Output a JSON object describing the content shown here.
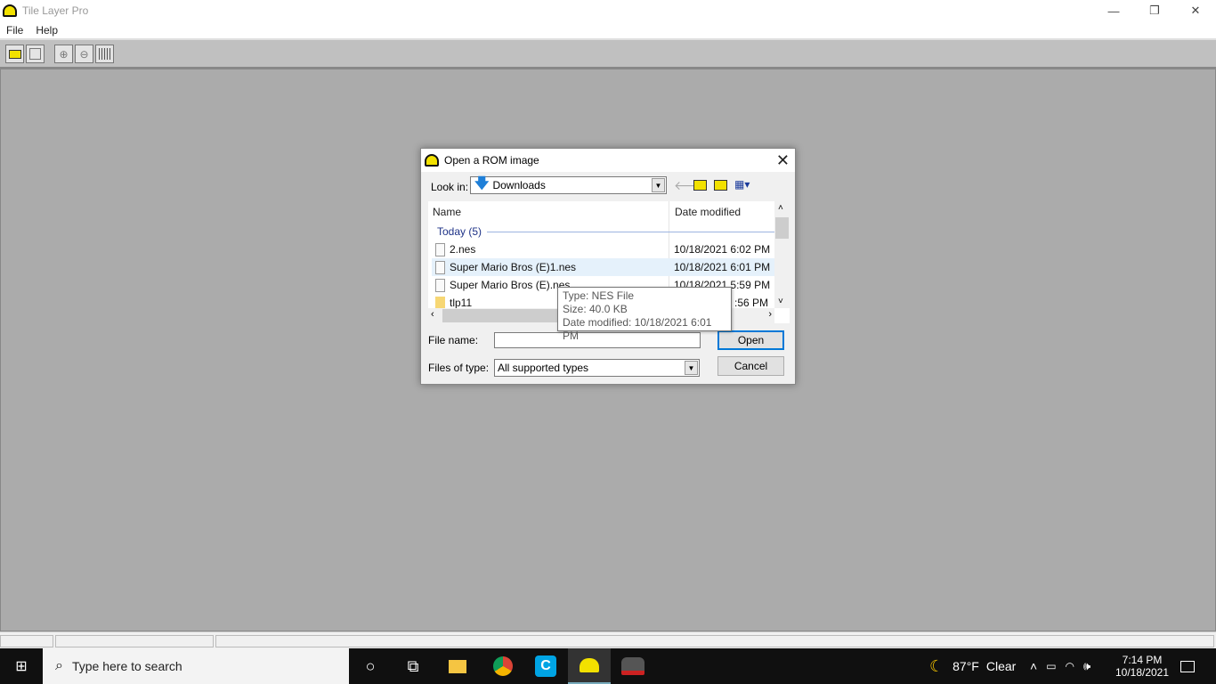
{
  "window": {
    "title": "Tile Layer Pro",
    "minimize": "—",
    "restore": "❐",
    "close": "✕"
  },
  "menu": [
    "File",
    "Help"
  ],
  "toolbar": {
    "icons": [
      "open-folder-icon",
      "save-icon",
      "zoom-in-icon",
      "zoom-out-icon",
      "grid-icon"
    ]
  },
  "dialog": {
    "title": "Open a ROM image",
    "close": "✕",
    "look_in_label": "Look in:",
    "look_in_value": "Downloads",
    "columns": {
      "name": "Name",
      "date": "Date modified"
    },
    "group": "Today (5)",
    "files": [
      {
        "name": "2.nes",
        "date": "10/18/2021 6:02 PM",
        "type": "file"
      },
      {
        "name": "Super Mario Bros (E)1.nes",
        "date": "10/18/2021 6:01 PM",
        "type": "file",
        "hovered": true
      },
      {
        "name": "Super Mario Bros (E).nes",
        "date": "10/18/2021 5:59 PM",
        "type": "file"
      },
      {
        "name": "tlp11",
        "date": ":56 PM",
        "type": "folder"
      }
    ],
    "tooltip": {
      "type": "Type: NES File",
      "size": "Size: 40.0 KB",
      "date": "Date modified: 10/18/2021 6:01 PM"
    },
    "file_name_label": "File name:",
    "file_name_value": "",
    "files_of_type_label": "Files of type:",
    "files_of_type_value": "All supported types",
    "open": "Open",
    "cancel": "Cancel"
  },
  "taskbar": {
    "search_placeholder": "Type here to search",
    "weather_temp": "87°F",
    "weather_cond": "Clear",
    "time": "7:14 PM",
    "date": "10/18/2021"
  }
}
